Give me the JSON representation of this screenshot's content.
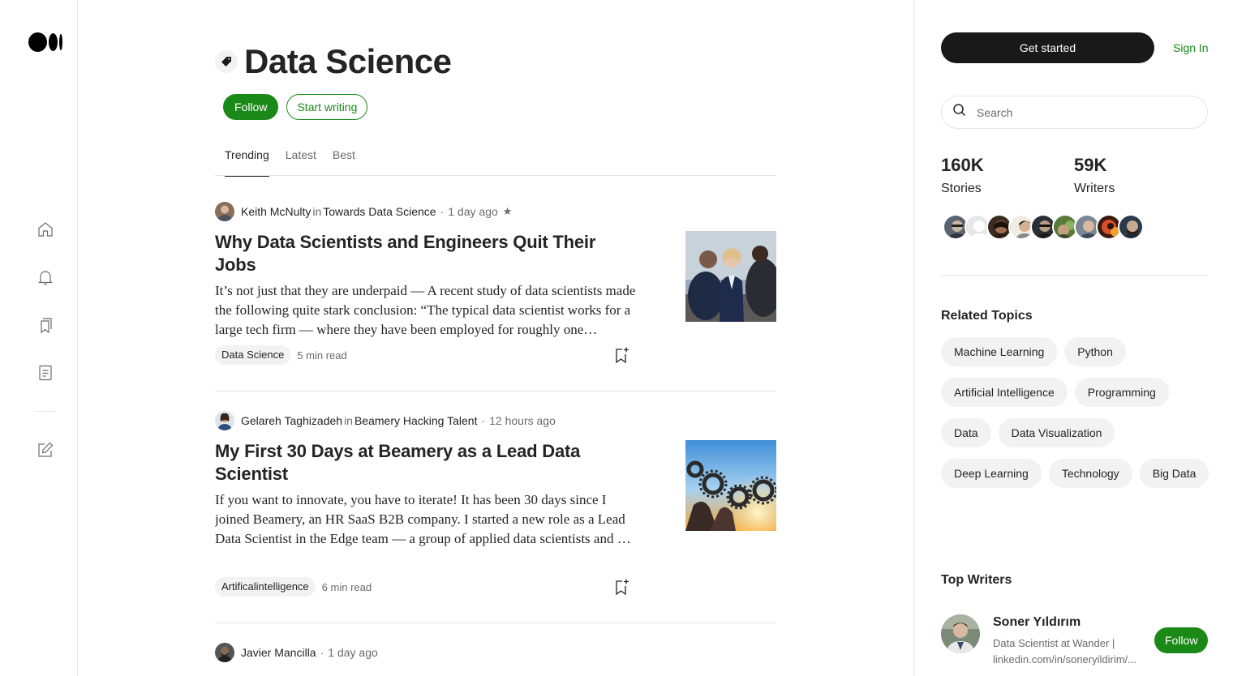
{
  "topic": {
    "title": "Data Science",
    "follow_label": "Follow",
    "start_writing_label": "Start writing"
  },
  "tabs": [
    {
      "label": "Trending",
      "active": true
    },
    {
      "label": "Latest",
      "active": false
    },
    {
      "label": "Best",
      "active": false
    }
  ],
  "articles": [
    {
      "author": "Keith McNulty",
      "in_label": "in",
      "publication": "Towards Data Science",
      "time": "1 day ago",
      "member_only": true,
      "title": "Why Data Scientists and Engineers Quit Their Jobs",
      "snippet": "It’s not just that they are underpaid — A recent study of data scientists made the following quite stark conclusion: “The typical data scientist works for a large tech firm — where they have been employed for roughly one…",
      "tag": "Data Science",
      "read_time": "5 min read"
    },
    {
      "author": "Gelareh Taghizadeh",
      "in_label": "in",
      "publication": "Beamery Hacking Talent",
      "time": "12 hours ago",
      "member_only": false,
      "title": "My First 30 Days at Beamery as a Lead Data Scientist",
      "snippet": "If you want to innovate, you have to iterate! It has been 30 days since I joined Beamery, an HR SaaS B2B company. I started a new role as a Lead Data Scientist in the Edge team — a group of applied data scientists and …",
      "tag": "Artificalintelligence",
      "read_time": "6 min read"
    },
    {
      "author": "Javier Mancilla",
      "time": "1 day ago"
    }
  ],
  "sidebar": {
    "get_started_label": "Get started",
    "sign_in_label": "Sign In",
    "search_placeholder": "Search",
    "stories_count": "160K",
    "stories_label": "Stories",
    "writers_count": "59K",
    "writers_label": "Writers",
    "related_topics_title": "Related Topics",
    "related_topics": [
      "Machine Learning",
      "Python",
      "Artificial Intelligence",
      "Programming",
      "Data",
      "Data Visualization",
      "Deep Learning",
      "Technology",
      "Big Data"
    ],
    "top_writers_title": "Top Writers",
    "top_writer": {
      "name": "Soner Yıldırım",
      "bio": "Data Scientist at Wander | linkedin.com/in/soneryildirim/...",
      "follow_label": "Follow"
    }
  },
  "colors": {
    "accent_green": "#1a8917",
    "text_primary": "#242424",
    "text_secondary": "#6b6b6b",
    "divider": "#e6e6e6",
    "pill_bg": "#f2f2f2",
    "dark_button": "#191919"
  },
  "icons": {
    "rail": [
      "home-icon",
      "bell-icon",
      "bookmarks-icon",
      "stories-icon",
      "write-icon"
    ],
    "topic": "tag-icon",
    "search": "search-icon",
    "save": "bookmark-add-icon"
  }
}
